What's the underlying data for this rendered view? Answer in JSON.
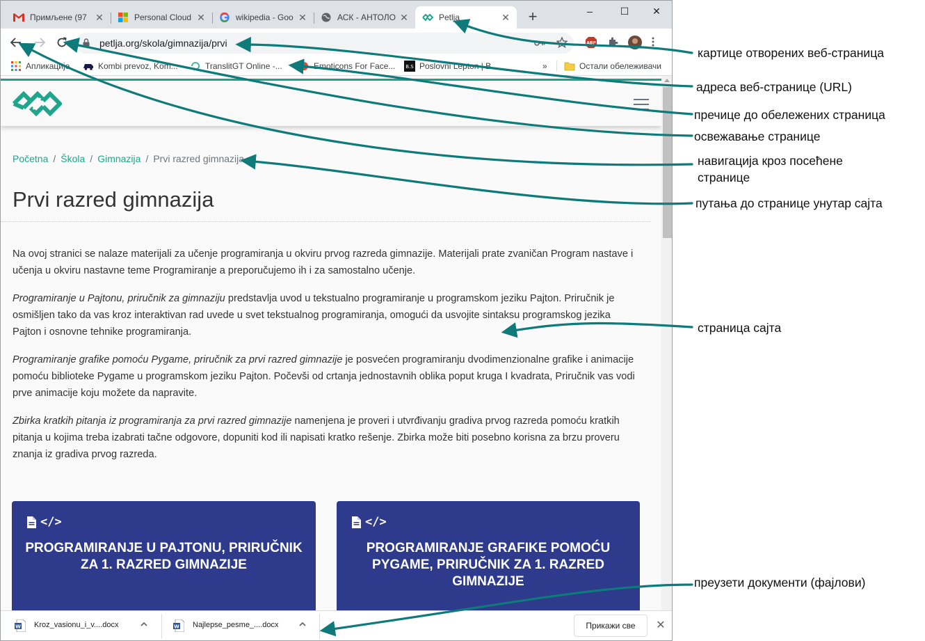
{
  "browser": {
    "tabs": [
      {
        "title": "Примљене (97",
        "icon": "gmail-icon"
      },
      {
        "title": "Personal Cloud",
        "icon": "microsoft-icon"
      },
      {
        "title": "wikipedia - Goo",
        "icon": "google-icon"
      },
      {
        "title": "АСК - АНТОЛО",
        "icon": "globe-icon"
      },
      {
        "title": "Petlja",
        "icon": "petlja-icon",
        "active": true
      }
    ],
    "new_tab_glyph": "+",
    "window_controls": {
      "minimize": "–",
      "maximize": "☐",
      "close": "✕"
    },
    "url": "petlja.org/skola/gimnazija/prvi",
    "bookmarks": [
      {
        "label": "Апликације",
        "icon": "apps-grid-icon"
      },
      {
        "label": "Kombi prevoz, Kom...",
        "icon": "van-icon"
      },
      {
        "label": "TranslitGT Online -...",
        "icon": "translit-icon"
      },
      {
        "label": "Emoticons For Face...",
        "icon": "emoticon-icon"
      },
      {
        "label": "Poslovni Lepton | B...",
        "icon": "bs-icon"
      }
    ],
    "bookmarks_overflow": "»",
    "other_bookmarks": "Остали обележивачи"
  },
  "page": {
    "breadcrumb": [
      {
        "label": "Početna",
        "link": true
      },
      {
        "label": "Škola",
        "link": true
      },
      {
        "label": "Gimnazija",
        "link": true
      },
      {
        "label": "Prvi razred gimnazija",
        "link": false
      }
    ],
    "breadcrumb_sep": "/",
    "title": "Prvi razred gimnazija",
    "paragraphs": [
      {
        "em": "",
        "text": "Na ovoj stranici se nalaze materijali za učenje programiranja u okviru prvog razreda gimnazije. Materijali prate zvaničan Program nastave i učenja u okviru nastavne teme Programiranje a preporučujemo ih i za samostalno učenje."
      },
      {
        "em": "Programiranje u Pajtonu, priručnik za gimnaziju",
        "text": " predstavlja uvod u tekstualno programiranje u programskom jeziku Pajton. Priručnik je osmišljen tako da vas kroz interaktivan rad uvede u svet tekstualnog programiranja, omogući da usvojite sintaksu programskog jezika Pajton i osnovne tehnike programiranja."
      },
      {
        "em": "Programiranje grafike pomoću Pygame, priručnik za prvi razred gimnazije",
        "text": " je posvećen programiranju dvodimenzionalne grafike i animacije pomoću biblioteke Pygame u programskom jeziku Pajton. Počevši od crtanja jednostavnih oblika poput kruga I kvadrata, Priručnik vas vodi prve animacije koju možete da napravite."
      },
      {
        "em": "Zbirka kratkih pitanja iz programiranja za prvi razred gimnazije",
        "text": " namenjena je proveri i utvrđivanju gradiva prvog razreda pomoću kratkih pitanja u kojima treba izabrati tačne odgovore, dopuniti kod ili napisati kratko rešenje. Zbirka može biti posebno korisna za brzu proveru znanja iz gradiva prvog razreda."
      }
    ],
    "cards": [
      {
        "title": "PROGRAMIRANJE U PAJTONU, PRIRUČNIK ZA 1. RAZRED GIMNAZIJE",
        "code_glyph": "</>"
      },
      {
        "title": "PROGRAMIRANJE GRAFIKE POMOĆU PYGAME, PRIRUČNIK ZA 1. RAZRED GIMNAZIJE",
        "code_glyph": "</>"
      }
    ],
    "accent_color": "#1fa58b",
    "card_color": "#2e3a8c"
  },
  "downloads": {
    "items": [
      {
        "name": "Kroz_vasionu_i_v....docx"
      },
      {
        "name": "Najlepse_pesme_....docx"
      }
    ],
    "show_all": "Прикажи све",
    "close_glyph": "✕"
  },
  "annotations": [
    {
      "text": "картице отворених веб-страница"
    },
    {
      "text": "адреса веб-странице (URL)"
    },
    {
      "text": "пречице до обележених страница"
    },
    {
      "text": "освежавање странице"
    },
    {
      "text": "навигација кроз посећене"
    },
    {
      "text": "странице"
    },
    {
      "text": "путања до странице унутар сајта"
    },
    {
      "text": "страница сајта"
    },
    {
      "text": "преузети документи (фајлови)"
    }
  ],
  "annotation_color": "#0e7a7a"
}
